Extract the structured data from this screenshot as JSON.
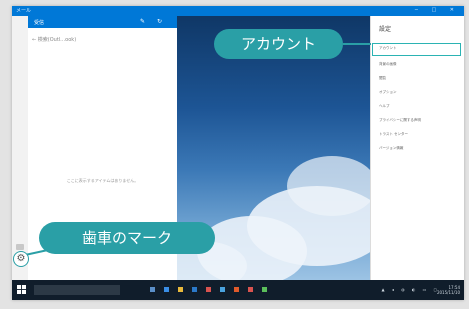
{
  "window": {
    "title": "メール",
    "controls": "─ □ ✕"
  },
  "mail": {
    "account_header": "受信",
    "toolbar_icons": "✎ ↻",
    "search_text": "← 検索(Outl…ook)",
    "empty_message": "ここに表示するアイテムはありません。"
  },
  "settings": {
    "title": "設定",
    "items": [
      "アカウント",
      "背景の画像",
      "閲覧",
      "オプション",
      "ヘルプ",
      "プライバシーに関する声明",
      "トラスト センター",
      "バージョン情報"
    ]
  },
  "taskbar": {
    "tray": "▲ ◂ ◍ ◐ ▭ ◻",
    "clock_time": "17:54",
    "clock_date": "2015/11/10"
  },
  "callouts": {
    "account": "アカウント",
    "gear": "歯車のマーク"
  },
  "colors": {
    "accent": "#0078d7",
    "callout": "#2a9fa6",
    "taskbar": "#101d2b"
  },
  "icons": {
    "gear": "gear-icon",
    "windows": "windows-start-icon"
  }
}
